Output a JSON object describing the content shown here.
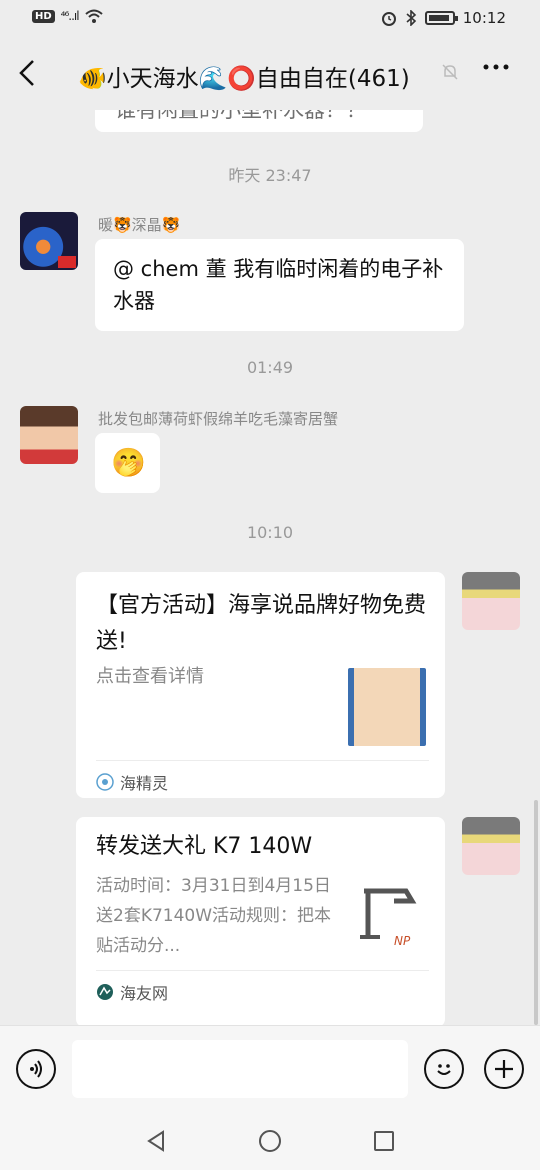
{
  "status_bar": {
    "hd": "HD",
    "signal": "⁴⁶..ıl",
    "wifi_icon": "wifi-icon",
    "time": "10:12"
  },
  "header": {
    "back_icon": "chevron-left-icon",
    "title": "🐠小天海水🌊⭕自由自在(461)",
    "mute_icon": "bell-off-icon",
    "more_icon": "more-dots-icon"
  },
  "messages": {
    "partial_prev": "谁有闲置的小型补水器？？",
    "ts1": "昨天 23:47",
    "msg1": {
      "sender": "暖🐯深晶🐯",
      "text": "@ chem 董  我有临时闲着的电子补水器"
    },
    "ts2": "01:49",
    "msg2": {
      "sender": "批发包邮薄荷虾假绵羊吃毛藻寄居蟹",
      "emoji": "🤭"
    },
    "ts3": "10:10",
    "card1": {
      "title": "【官方活动】海享说品牌好物免费送!",
      "desc": "点击查看详情",
      "source": "海精灵"
    },
    "card2": {
      "title": "转发送大礼 K7 140W",
      "desc": "活动时间：3月31日到4月15日送2套K7140W活动规则：把本贴活动分...",
      "source": "海友网",
      "thumb_text": "NP"
    }
  },
  "input_bar": {
    "voice_icon": "voice-icon",
    "emoji_icon": "emoji-icon",
    "plus_icon": "plus-icon"
  },
  "nav_bar": {
    "back_icon": "triangle-back-icon",
    "home_icon": "circle-home-icon",
    "recent_icon": "square-recent-icon"
  },
  "colors": {
    "background": "#ededed",
    "bubble": "#ffffff",
    "timestamp": "#999999"
  }
}
